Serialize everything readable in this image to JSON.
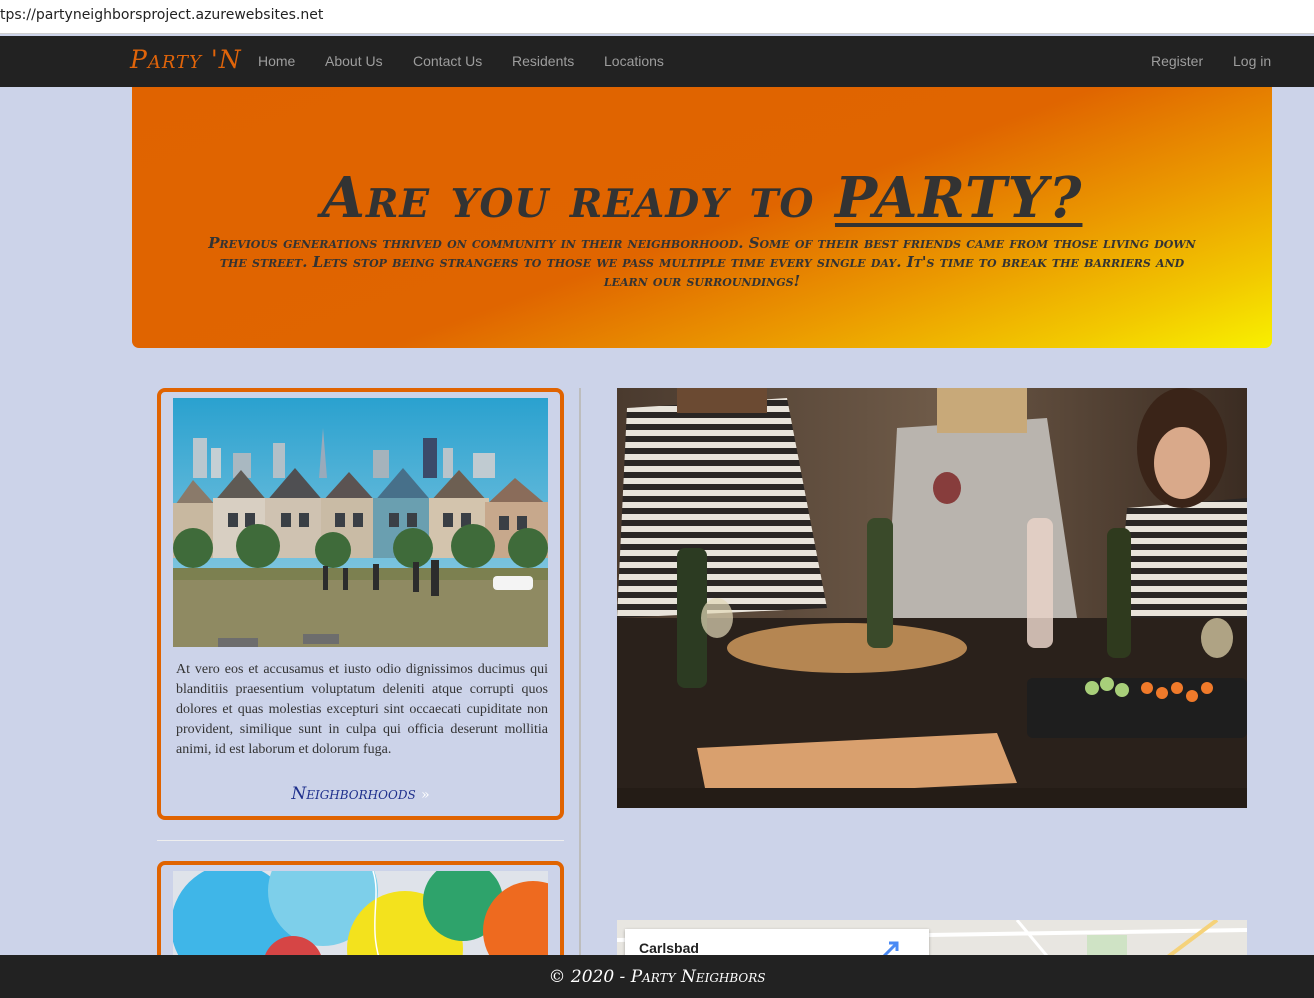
{
  "browser": {
    "url": "tps://partyneighborsproject.azurewebsites.net"
  },
  "navbar": {
    "brand": "Party 'N",
    "links": [
      "Home",
      "About Us",
      "Contact Us",
      "Residents",
      "Locations"
    ],
    "right_links": [
      "Register",
      "Log in"
    ]
  },
  "hero": {
    "title_prefix": "Are you ready to",
    "title_emphasis": "PARTY?",
    "text": "Previous generations thrived on community in their neighborhood. Some of their best friends came from those living down the street. Lets stop being strangers to those we pass multiple time every single day. It's time to break the barriers and learn our surroundings!"
  },
  "card1": {
    "image": "neighborhood-houses-photo",
    "text": "At vero eos et accusamus et iusto odio dignissimos ducimus qui blanditiis praesentium voluptatum deleniti atque corrupti quos dolores et quas molestias excepturi sint occaecati cupiditate non provident, similique sunt in culpa qui officia deserunt mollitia animi, id est laborum et dolorum fuga.",
    "link": "Neighborhoods",
    "link_icon": "double-chevron-right-icon"
  },
  "card2": {
    "image": "balloons-photo"
  },
  "photo": {
    "image": "dinner-party-photo"
  },
  "map": {
    "place": "Carlsbad",
    "directions_icon": "directions-arrow-icon"
  },
  "footer": {
    "text": "© 2020 - Party Neighbors"
  },
  "colors": {
    "accent": "#e06300",
    "navbar": "#222222",
    "background": "#ccd3e9",
    "link": "#1e2f8c"
  }
}
